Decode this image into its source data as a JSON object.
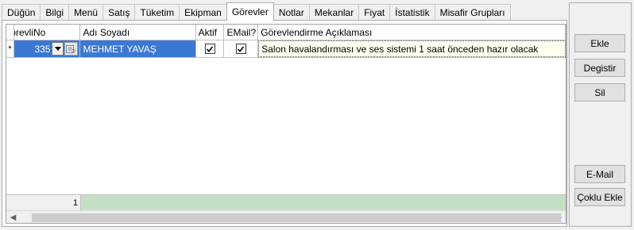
{
  "tabs": [
    {
      "label": "Düğün",
      "active": false
    },
    {
      "label": "Bilgi",
      "active": false
    },
    {
      "label": "Menü",
      "active": false
    },
    {
      "label": "Satış",
      "active": false
    },
    {
      "label": "Tüketim",
      "active": false
    },
    {
      "label": "Ekipman",
      "active": false
    },
    {
      "label": "Görevler",
      "active": true
    },
    {
      "label": "Notlar",
      "active": false
    },
    {
      "label": "Mekanlar",
      "active": false
    },
    {
      "label": "Fiyat",
      "active": false
    },
    {
      "label": "İstatistik",
      "active": false
    },
    {
      "label": "Misafir Grupları",
      "active": false
    }
  ],
  "grid": {
    "columns": {
      "gorevli_no": "GörevliNo",
      "adi_soyadi": "Adı Soyadı",
      "aktif": "Aktif",
      "email": "EMail?",
      "aciklama": "Görevlendirme Açıklaması"
    },
    "row": {
      "indicator": "*",
      "gorevli_no": "335",
      "adi_soyadi": "MEHMET YAVAŞ",
      "aktif": true,
      "email": true,
      "aciklama": "Salon havalandırması ve ses sistemi 1 saat önceden hazır olacak"
    },
    "footer_count": "1"
  },
  "buttons": {
    "ekle": "Ekle",
    "degistir": "Degistir",
    "sil": "Sil",
    "email": "E-Mail",
    "coklu_ekle": "Çoklu Ekle"
  },
  "colors": {
    "selection": "#3a78d4",
    "footer_green": "#c5dfc5",
    "note_yellow": "#fffff0"
  }
}
